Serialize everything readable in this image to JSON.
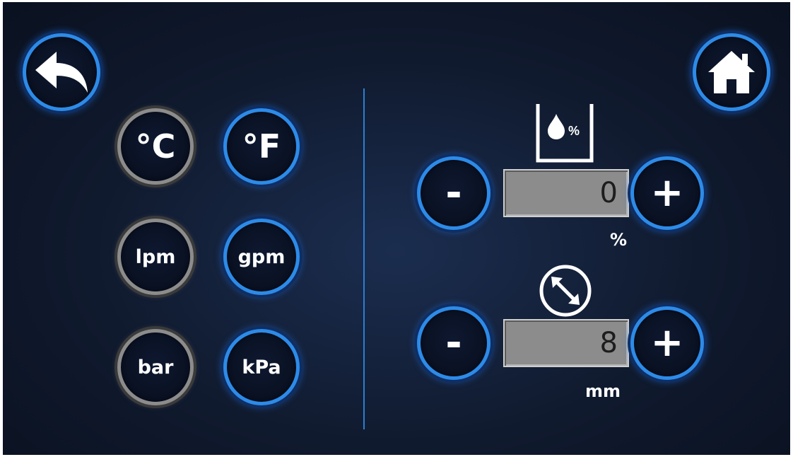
{
  "nav": {
    "back_icon": "back-arrow-icon",
    "home_icon": "home-icon"
  },
  "units": {
    "temperature": {
      "celsius": "°C",
      "fahrenheit": "°F",
      "selected": "°F"
    },
    "flow": {
      "lpm": "lpm",
      "gpm": "gpm",
      "selected": "gpm"
    },
    "pressure": {
      "bar": "bar",
      "kpa": "kPa",
      "selected": "kPa"
    }
  },
  "moisture": {
    "icon": "moisture-percent-icon",
    "icon_text": "%",
    "minus_label": "-",
    "plus_label": "+",
    "value": "0",
    "unit": "%"
  },
  "size": {
    "icon": "diameter-icon",
    "minus_label": "-",
    "plus_label": "+",
    "value": "8",
    "unit": "mm"
  },
  "colors": {
    "accent": "#2d8be8",
    "inactive": "#8c8c8c",
    "background": "#101a2e",
    "field": "#8c8c8c"
  }
}
